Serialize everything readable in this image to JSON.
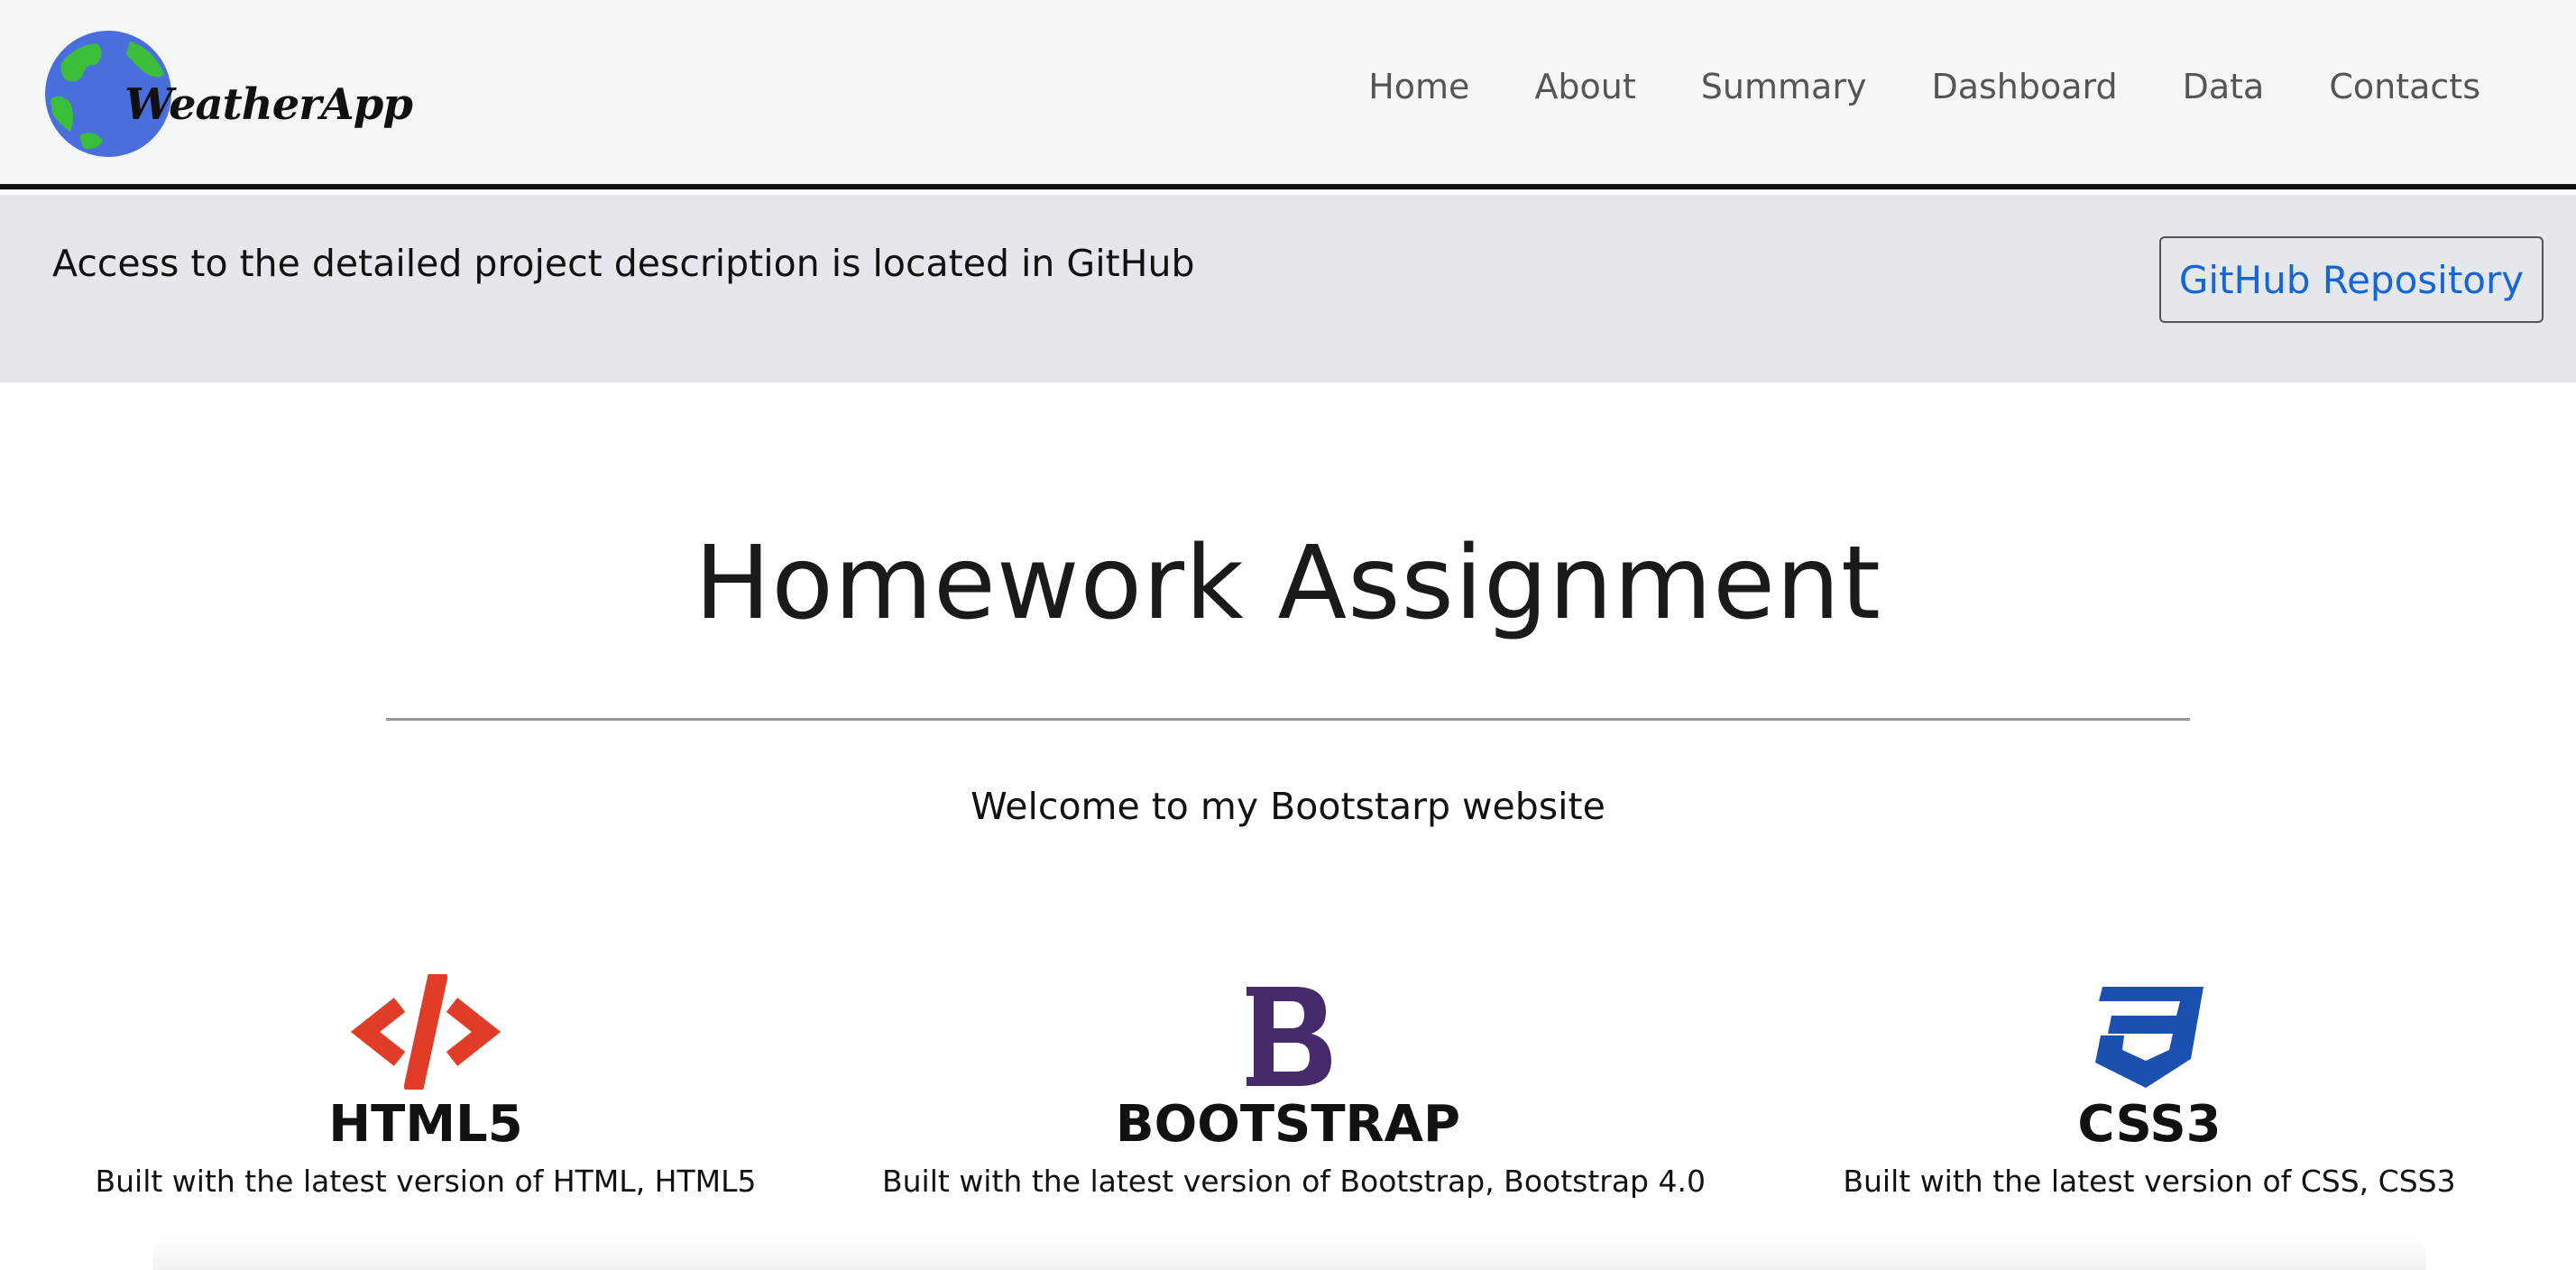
{
  "navbar": {
    "brand": "WeatherApp",
    "links": [
      "Home",
      "About",
      "Summary",
      "Dashboard",
      "Data",
      "Contacts"
    ]
  },
  "banner": {
    "text": "Access to the detailed project description is located in GitHub",
    "button_label": "GitHub Repository"
  },
  "hero": {
    "title": "Homework Assignment",
    "subtitle": "Welcome to my Bootstarp website"
  },
  "features": [
    {
      "name": "HTML5",
      "description": "Built with the latest version of HTML, HTML5",
      "icon": "html5-code-icon",
      "color": "#e03c28"
    },
    {
      "name": "BOOTSTRAP",
      "description": "Built with the latest version of Bootstrap, Bootstrap 4.0",
      "icon": "bootstrap-b-icon",
      "color": "#452b6b"
    },
    {
      "name": "CSS3",
      "description": "Built with the latest version of CSS, CSS3",
      "icon": "css3-shield-icon",
      "color": "#1b4fb0"
    }
  ],
  "colors": {
    "link_blue": "#1565d8",
    "globe_blue": "#4a6fdc",
    "globe_green": "#3bbf3b"
  }
}
